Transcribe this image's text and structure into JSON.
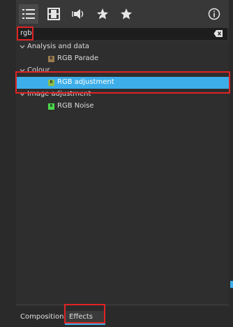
{
  "colors": {
    "accent": "#3daee9",
    "highlight": "#e02424",
    "swatch_parade": "#9a7b4f",
    "swatch_adjustment": "#8fbf4a",
    "swatch_noise": "#4ad94a"
  },
  "toolbar": {
    "icons": [
      "list-icon",
      "film-icon",
      "audio-icon",
      "star-outline-icon",
      "star-icon",
      "info-icon"
    ]
  },
  "search": {
    "value": "rgb",
    "clear_icon": "backspace-icon"
  },
  "tree": {
    "groups": [
      {
        "label": "Analysis and data",
        "items": [
          {
            "label": "RGB Parade",
            "badge": "R"
          }
        ]
      },
      {
        "label": "Colour",
        "items": [
          {
            "label": "RGB adjustment",
            "badge": "R",
            "selected": true
          }
        ]
      },
      {
        "label": "Image adjustment",
        "items": [
          {
            "label": "RGB Noise",
            "badge": "R"
          }
        ]
      }
    ]
  },
  "bottom_tabs": [
    {
      "label": "Compositions"
    },
    {
      "label": "Effects",
      "active": true
    }
  ]
}
